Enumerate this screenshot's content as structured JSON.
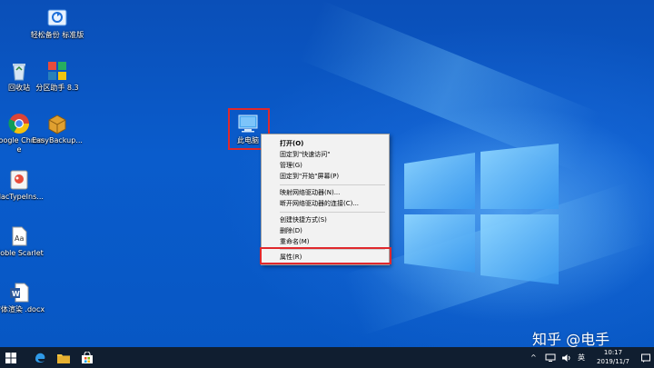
{
  "desktop": {
    "icons": [
      {
        "label": "轻松备份 标准版",
        "icon": "backup-app-icon"
      },
      {
        "label": "回收站",
        "icon": "recycle-bin-icon"
      },
      {
        "label": "分区助手 8.3",
        "icon": "partition-assistant-icon"
      },
      {
        "label": "Google Chrome",
        "icon": "chrome-icon"
      },
      {
        "label": "EasyBackup...",
        "icon": "easybackup-icon"
      },
      {
        "label": "MacTypeIns...",
        "icon": "mactype-icon"
      },
      {
        "label": "Noble Scarlet",
        "icon": "document-icon"
      },
      {
        "label": "字体渲染 .docx",
        "icon": "word-doc-icon"
      },
      {
        "label": "此电脑",
        "icon": "this-pc-icon"
      }
    ]
  },
  "context_menu": {
    "items": [
      {
        "label": "打开(O)",
        "bold": true
      },
      {
        "label": "固定到\"快速访问\""
      },
      {
        "label": "管理(G)"
      },
      {
        "label": "固定到\"开始\"屏幕(P)"
      },
      {
        "label": "映射网络驱动器(N)..."
      },
      {
        "label": "断开网络驱动器的连接(C)..."
      },
      {
        "label": "创建快捷方式(S)"
      },
      {
        "label": "删除(D)"
      },
      {
        "label": "重命名(M)"
      },
      {
        "label": "属性(R)"
      }
    ]
  },
  "taskbar": {
    "start": "windows-start-icon",
    "pinned": [
      "edge-icon",
      "file-explorer-icon",
      "store-icon"
    ],
    "tray": {
      "ime": "英",
      "time": "10:17",
      "date": "2019/11/7"
    }
  },
  "watermark": "知乎 @电手",
  "colors": {
    "highlight_border": "#e0282c",
    "taskbar": "#101e30",
    "desktop": "#0a5ccc"
  }
}
